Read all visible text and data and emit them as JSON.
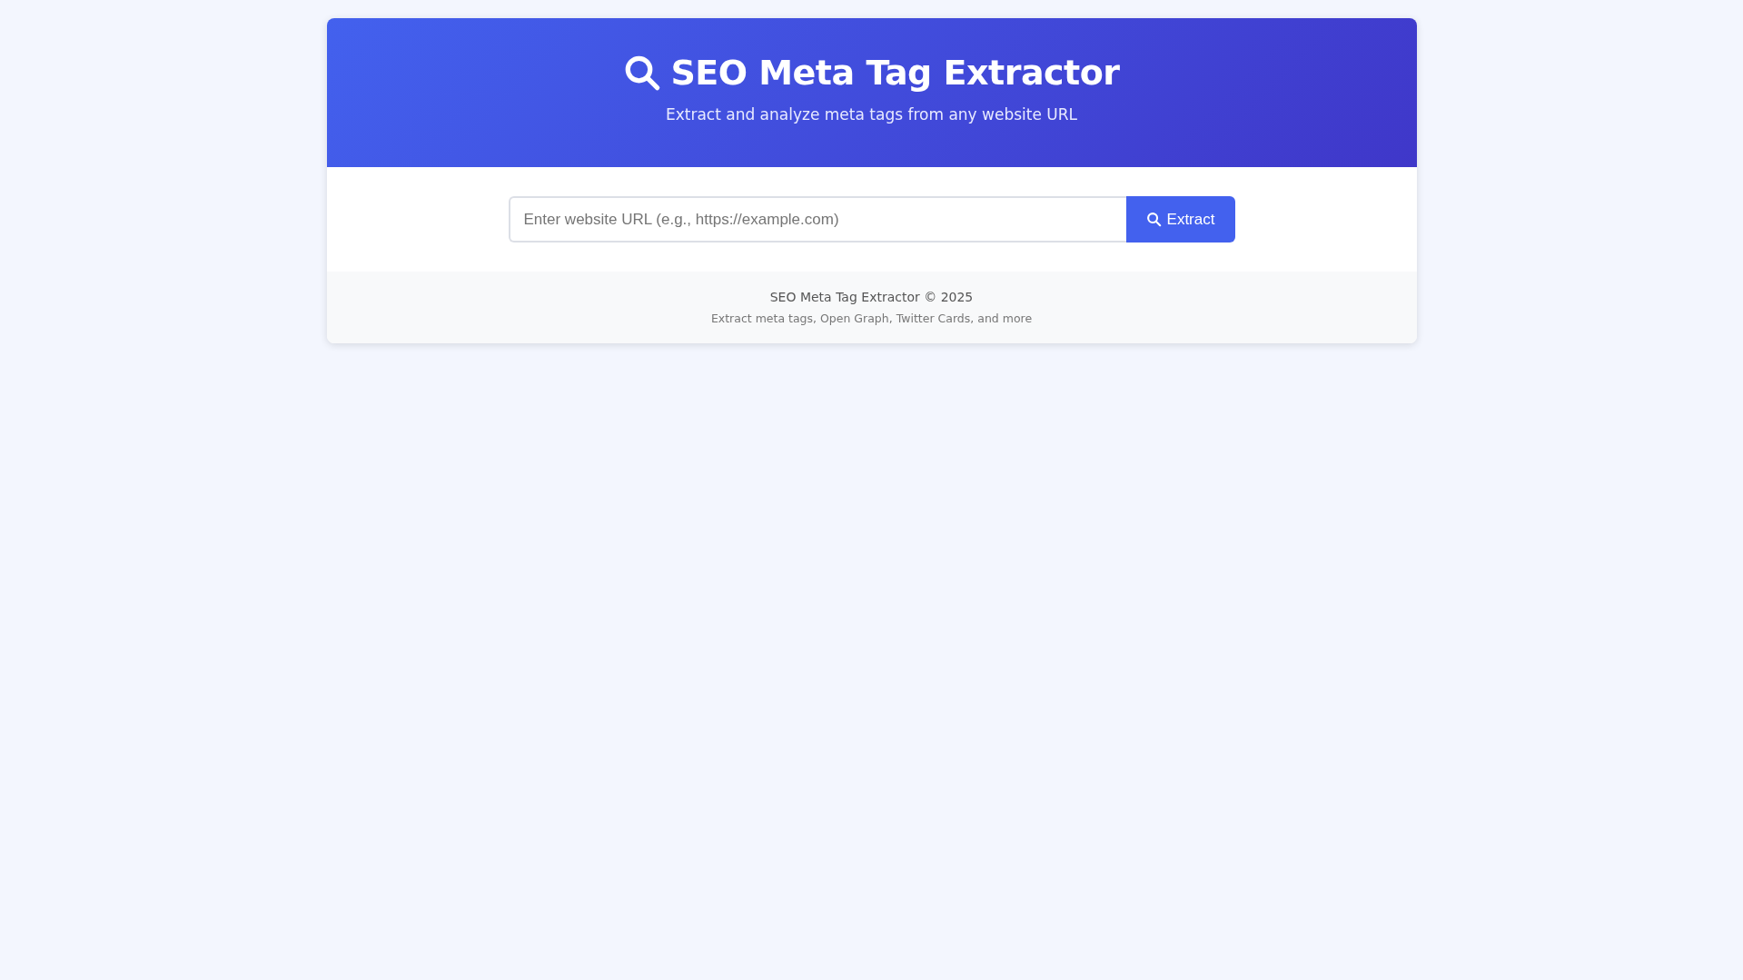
{
  "header": {
    "title": "SEO Meta Tag Extractor",
    "subtitle": "Extract and analyze meta tags from any website URL"
  },
  "search": {
    "placeholder": "Enter website URL (e.g., https://example.com)",
    "button": "Extract"
  },
  "footer": {
    "line_1": "SEO Meta Tag Extractor © 2025",
    "line_2": "Extract meta tags, Open Graph, Twitter Cards, and more"
  }
}
